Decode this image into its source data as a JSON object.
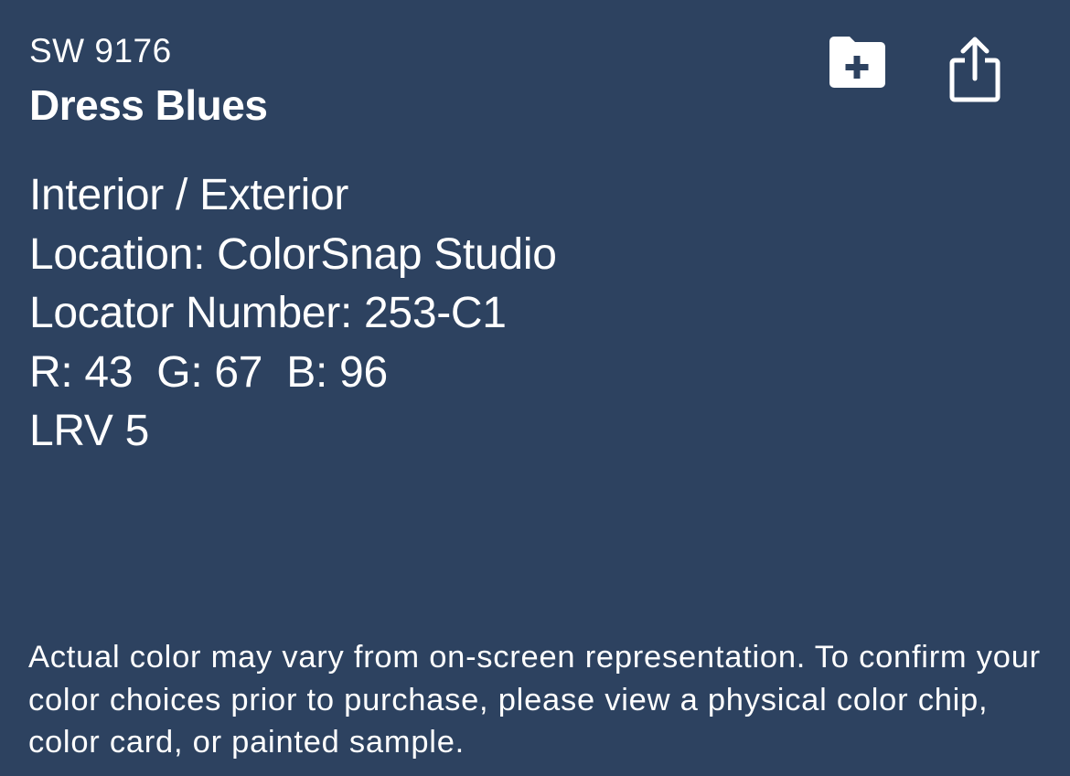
{
  "color": {
    "code": "SW 9176",
    "name": "Dress Blues",
    "hex": "#2d4260"
  },
  "details": [
    "Interior / Exterior",
    "Location: ColorSnap Studio",
    "Locator Number: 253-C1",
    "R: 43  G: 67  B: 96",
    "LRV 5"
  ],
  "actions": {
    "add_to_folder_icon": "folder-plus-icon",
    "share_icon": "share-icon"
  },
  "disclaimer": "Actual color may vary from on-screen representation. To confirm your color choices prior to purchase, please view a physical color chip, color card, or painted sample."
}
